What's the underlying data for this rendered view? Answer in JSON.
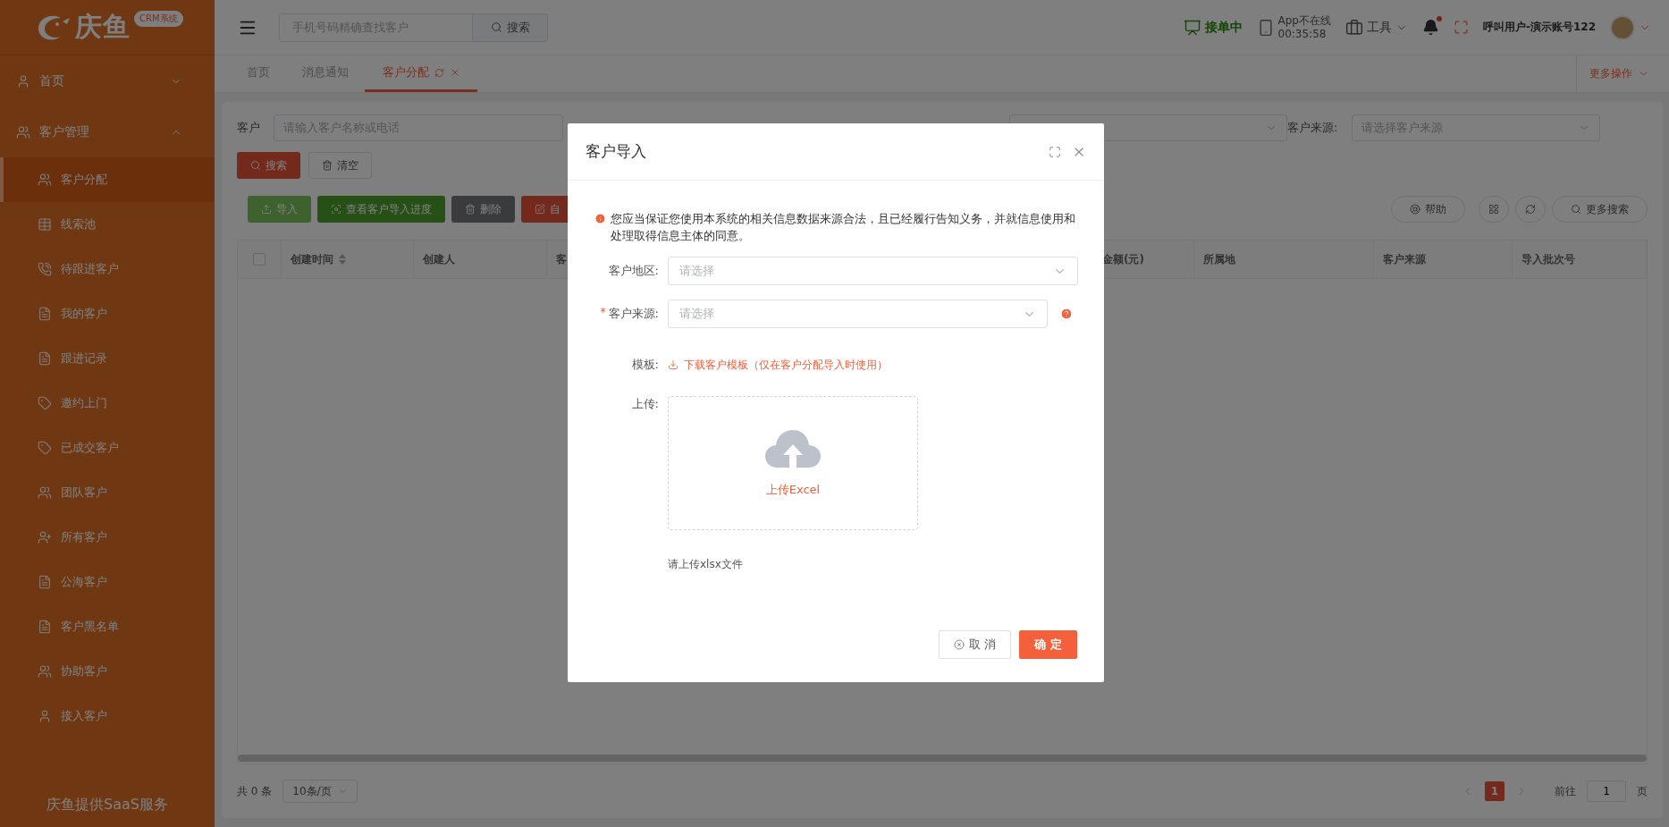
{
  "sidebar": {
    "logo": {
      "name": "庆鱼",
      "badge": "CRM系统"
    },
    "menu": [
      {
        "label": "首页",
        "kind": "person",
        "expanded": false
      },
      {
        "label": "客户管理",
        "kind": "team",
        "expanded": true,
        "children": [
          {
            "label": "客户分配",
            "kind": "team",
            "selected": true
          },
          {
            "label": "线索池",
            "kind": "grid",
            "selected": false
          },
          {
            "label": "待跟进客户",
            "kind": "phone",
            "selected": false
          },
          {
            "label": "我的客户",
            "kind": "document",
            "selected": false
          },
          {
            "label": "跟进记录",
            "kind": "document",
            "selected": false
          },
          {
            "label": "邀约上门",
            "kind": "tag",
            "selected": false
          },
          {
            "label": "已成交客户",
            "kind": "tag",
            "selected": false
          },
          {
            "label": "团队客户",
            "kind": "team",
            "selected": false
          },
          {
            "label": "所有客户",
            "kind": "person-add",
            "selected": false
          },
          {
            "label": "公海客户",
            "kind": "document",
            "selected": false
          },
          {
            "label": "客户黑名单",
            "kind": "document",
            "selected": false
          },
          {
            "label": "协助客户",
            "kind": "team",
            "selected": false
          },
          {
            "label": "接入客户",
            "kind": "person",
            "selected": false
          }
        ]
      }
    ],
    "footer": "庆鱼提供SaaS服务"
  },
  "header": {
    "search": {
      "placeholder": "手机号码精确查找客户",
      "button": "搜索"
    },
    "status": "接单中",
    "app_status": "App不在线",
    "app_time": "00:35:58",
    "tools": "工具",
    "notification_dot": true,
    "user": "呼叫用户-演示账号122"
  },
  "tabs": [
    {
      "label": "首页",
      "selected": false
    },
    {
      "label": "消息通知",
      "selected": false
    },
    {
      "label": "客户分配",
      "selected": true
    }
  ],
  "more_actions": "更多操作",
  "filters": [
    {
      "kind": "input",
      "label": "客户",
      "placeholder": "请输入客户名称或电话"
    },
    {
      "kind": "select"
    },
    {
      "kind": "select",
      "label": "客户来源:",
      "placeholder": "请选择客户来源"
    }
  ],
  "search_buttons": [
    {
      "label": "搜索",
      "kind": "primary"
    },
    {
      "label": "清空",
      "kind": "plain"
    }
  ],
  "toolbar": [
    {
      "label": "导入",
      "kind": "light-green"
    },
    {
      "label": "查看客户导入进度",
      "kind": "green"
    },
    {
      "label": "删除",
      "kind": "grey"
    },
    {
      "label": "自",
      "kind": "red"
    }
  ],
  "toolbar_right": [
    {
      "kind": "help",
      "label": "帮助"
    },
    {
      "kind": "grid"
    },
    {
      "kind": "refresh"
    },
    {
      "kind": "search",
      "label": "更多搜索"
    }
  ],
  "table": {
    "select_all_checked": false,
    "columns": [
      {
        "label": "创建时间",
        "sortable": true
      },
      {
        "label": "创建人",
        "sortable": false
      },
      {
        "label": "客",
        "sortable": false
      },
      {
        "label": "金额(元)",
        "sortable": false
      },
      {
        "label": "所属地",
        "sortable": false
      },
      {
        "label": "客户来源",
        "sortable": false
      },
      {
        "label": "导入批次号",
        "sortable": false
      }
    ]
  },
  "pagination": {
    "total": "共 0 条",
    "page_size": "10条/页",
    "pages": [
      {
        "label": "1",
        "selected": true
      }
    ],
    "goto_label": "前往",
    "goto_value": "1",
    "page_suffix": "页"
  },
  "dialog": {
    "title": "客户导入",
    "notice": "您应当保证您使用本系统的相关信息数据来源合法，且已经履行告知义务，并就信息使用和处理取得信息主体的同意。",
    "fields": [
      {
        "kind": "select",
        "label": "客户地区:",
        "placeholder": "请选择",
        "help": false
      },
      {
        "kind": "select",
        "label": "客户来源:",
        "placeholder": "请选择",
        "required_mark": "*",
        "help": true
      },
      {
        "kind": "link",
        "label": "模板:",
        "text": "下载客户模板（仅在客户分配导入时使用）"
      },
      {
        "kind": "upload",
        "label": "上传:",
        "text": "上传Excel",
        "hint": "请上传xlsx文件"
      }
    ],
    "buttons": [
      {
        "label": "取 消",
        "kind": "plain"
      },
      {
        "label": "确 定",
        "kind": "primary"
      }
    ]
  }
}
